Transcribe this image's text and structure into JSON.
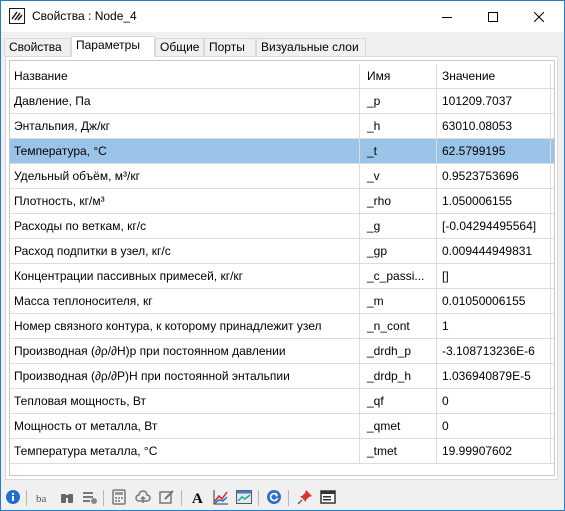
{
  "window": {
    "title": "Свойства : Node_4"
  },
  "tabs": [
    {
      "label": "Свойства"
    },
    {
      "label": "Параметры"
    },
    {
      "label": "Общие"
    },
    {
      "label": "Порты"
    },
    {
      "label": "Визуальные слои"
    }
  ],
  "active_tab": "Параметры",
  "table": {
    "headers": {
      "name": "Название",
      "id": "Имя",
      "value": "Значение"
    },
    "selected_row": "Температура, °С",
    "rows": [
      {
        "name": "Давление, Па",
        "id": "_p",
        "value": "101209.7037"
      },
      {
        "name": "Энтальпия, Дж/кг",
        "id": "_h",
        "value": "63010.08053"
      },
      {
        "name": "Температура, °С",
        "id": "_t",
        "value": "62.5799195"
      },
      {
        "name": "Удельный объём, м³/кг",
        "id": "_v",
        "value": "0.9523753696"
      },
      {
        "name": "Плотность, кг/м³",
        "id": "_rho",
        "value": "1.050006155"
      },
      {
        "name": "Расходы по веткам, кг/с",
        "id": "_g",
        "value": "[-0.04294495564]"
      },
      {
        "name": "Расход подпитки в узел, кг/с",
        "id": "_gp",
        "value": "0.009444949831"
      },
      {
        "name": "Концентрации пассивных примесей, кг/кг",
        "id": "_c_passi...",
        "value": "[]"
      },
      {
        "name": "Масса теплоносителя, кг",
        "id": "_m",
        "value": "0.01050006155"
      },
      {
        "name": "Номер связного контура, к которому принадлежит узел",
        "id": "_n_cont",
        "value": "1"
      },
      {
        "name": "Производная (∂ρ/∂H)р при постоянном давлении",
        "id": "_drdh_p",
        "value": "-3.108713236E-6"
      },
      {
        "name": "Производная (∂ρ/∂P)H при постоянной энтальпии",
        "id": "_drdp_h",
        "value": "1.036940879E-5"
      },
      {
        "name": "Тепловая мощность, Вт",
        "id": "_qf",
        "value": "0"
      },
      {
        "name": "Мощность от металла, Вт",
        "id": "_qmet",
        "value": "0"
      },
      {
        "name": "Температура металла, °С",
        "id": "_tmet",
        "value": "19.99907602"
      }
    ]
  },
  "toolbar": {
    "icons": [
      "info-icon",
      "font-size-icon",
      "binoculars-icon",
      "list-settings-icon",
      "calculator-icon",
      "upload-cloud-icon",
      "edit-icon",
      "font-icon",
      "chart-icon",
      "chart-window-icon",
      "refresh-icon",
      "pin-icon",
      "window-list-icon"
    ]
  },
  "colors": {
    "selection": "#99c4e8",
    "window_border": "#2b7bc4"
  }
}
